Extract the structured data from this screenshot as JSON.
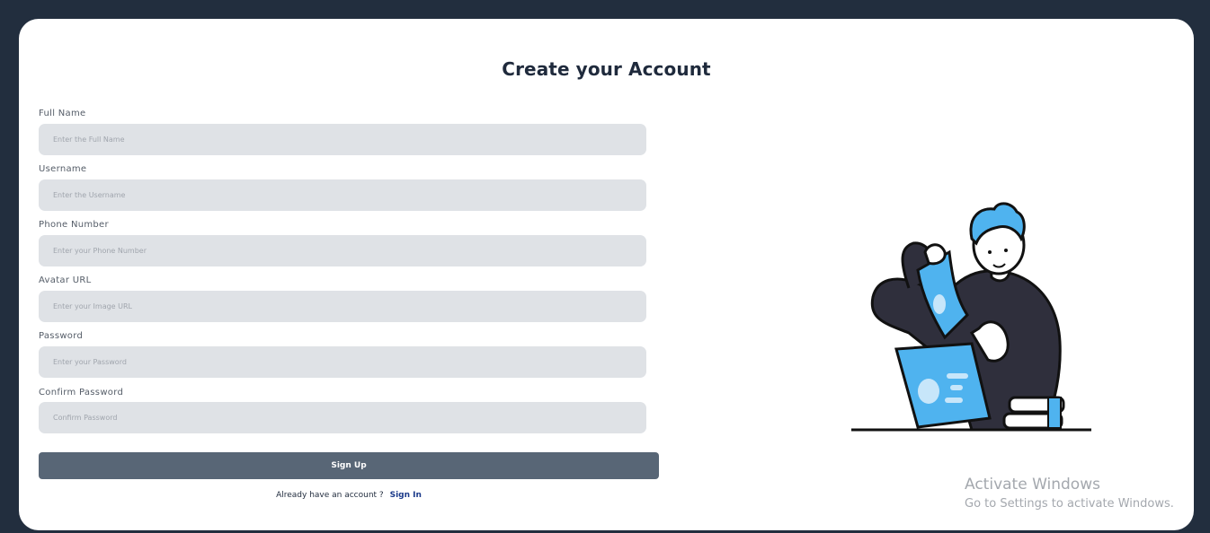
{
  "form": {
    "title": "Create your Account",
    "fields": [
      {
        "label": "Full Name",
        "placeholder": "Enter the Full Name",
        "value": ""
      },
      {
        "label": "Username",
        "placeholder": "Enter the Username",
        "value": ""
      },
      {
        "label": "Phone Number",
        "placeholder": "Enter your Phone Number",
        "value": ""
      },
      {
        "label": "Avatar URL",
        "placeholder": "Enter your Image URL",
        "value": ""
      },
      {
        "label": "Password",
        "placeholder": "Enter your Password",
        "value": ""
      },
      {
        "label": "Confirm Password",
        "placeholder": "Confirm Password",
        "value": ""
      }
    ],
    "submit_label": "Sign Up",
    "signin_prompt": "Already have an account ?",
    "signin_link": "Sign In"
  },
  "illustration": {
    "icon": "person-with-laptop-illustration",
    "colors": {
      "accent": "#4fb3ef",
      "dark": "#2f2f3c",
      "outline": "#111111"
    }
  },
  "watermark": {
    "title": "Activate Windows",
    "subtitle": "Go to Settings to activate Windows."
  },
  "colors": {
    "background": "#222e3e",
    "card": "#ffffff",
    "input_bg": "#dfe2e6",
    "button": "#586676",
    "title_text": "#1f2a3c"
  }
}
